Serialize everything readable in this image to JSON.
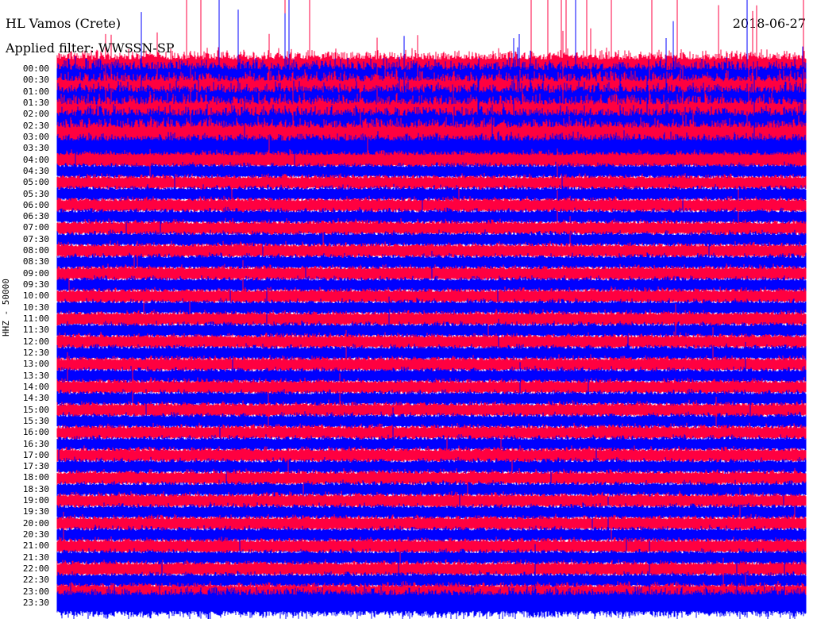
{
  "header": {
    "station": "HL Vamos (Crete)",
    "date": "2018-06-27",
    "filter": "Applied filter: WWSSN-SP"
  },
  "chart_data": {
    "type": "line",
    "title": "HL Vamos (Crete)",
    "ylabel": "HHZ - 50000",
    "row_minutes": 30,
    "row_labels": [
      "00:00",
      "00:30",
      "01:00",
      "01:30",
      "02:00",
      "02:30",
      "03:00",
      "03:30",
      "04:00",
      "04:30",
      "05:00",
      "05:30",
      "06:00",
      "06:30",
      "07:00",
      "07:30",
      "08:00",
      "08:30",
      "09:00",
      "09:30",
      "10:00",
      "10:30",
      "11:00",
      "11:30",
      "12:00",
      "12:30",
      "13:00",
      "13:30",
      "14:00",
      "14:30",
      "15:00",
      "15:30",
      "16:00",
      "16:30",
      "17:00",
      "17:30",
      "18:00",
      "18:30",
      "19:00",
      "19:30",
      "20:00",
      "20:30",
      "21:00",
      "21:30",
      "22:00",
      "22:30",
      "23:00",
      "23:30"
    ],
    "row_colors": [
      "#ff0040",
      "#0000ff"
    ],
    "relative_noise_level": [
      2.2,
      2.4,
      2.4,
      2.4,
      2.3,
      2.3,
      2.2,
      1.8,
      1.1,
      1.0,
      1.0,
      1.0,
      1.0,
      1.0,
      1.0,
      1.0,
      1.0,
      1.0,
      1.0,
      1.0,
      1.0,
      1.0,
      1.0,
      1.0,
      1.0,
      1.0,
      1.0,
      1.0,
      1.0,
      1.0,
      1.0,
      1.0,
      1.0,
      1.0,
      1.0,
      1.0,
      1.0,
      1.0,
      1.0,
      1.0,
      1.0,
      1.0,
      1.0,
      1.0,
      1.0,
      1.0,
      1.1,
      1.8
    ],
    "spikes_per_row": [
      14,
      6,
      6,
      6,
      6,
      6,
      5,
      3,
      2,
      2,
      2,
      2,
      2,
      2,
      2,
      2,
      2,
      2,
      2,
      2,
      2,
      2,
      2,
      2,
      2,
      2,
      2,
      2,
      2,
      2,
      2,
      2,
      2,
      2,
      2,
      2,
      2,
      2,
      2,
      2,
      2,
      2,
      2,
      2,
      2,
      2,
      2,
      4
    ]
  }
}
